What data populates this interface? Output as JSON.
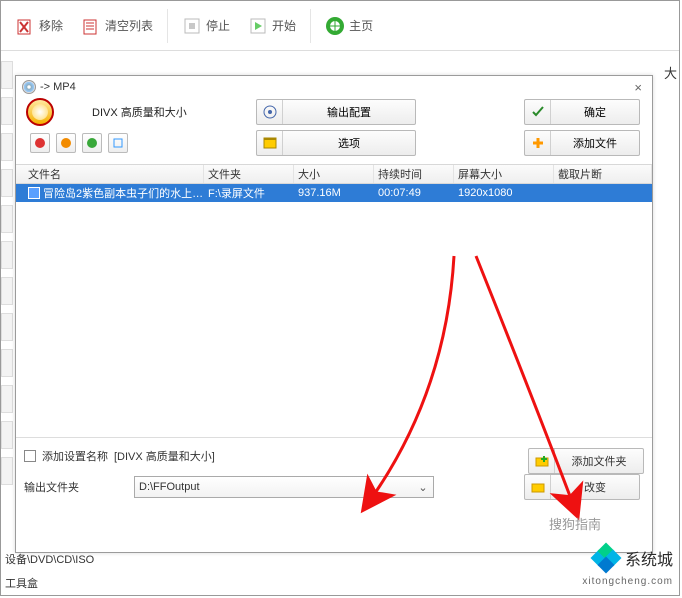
{
  "back_toolbar": {
    "remove": "移除",
    "clear": "清空列表",
    "stop": "停止",
    "start": "开始",
    "home": "主页"
  },
  "dialog": {
    "title": "-> MP4",
    "profile": "DIVX 高质量和大小",
    "btn_output_config": "输出配置",
    "btn_ok": "确定",
    "btn_options": "选项",
    "btn_add_file": "添加文件",
    "columns": {
      "c0": "文件名",
      "c1": "文件夹",
      "c2": "大小",
      "c3": "持续时间",
      "c4": "屏幕大小",
      "c5": "截取片断"
    },
    "row": {
      "name": "冒险岛2紫色副本虫子们的水上乐园水...",
      "folder": "F:\\录屏文件",
      "size": "937.16M",
      "duration": "00:07:49",
      "screen": "1920x1080",
      "clip": ""
    },
    "add_settings_label": "添加设置名称",
    "add_settings_value": "[DIVX 高质量和大小]",
    "btn_add_folder": "添加文件夹",
    "output_label": "输出文件夹",
    "output_path": "D:\\FFOutput",
    "btn_change": "改变"
  },
  "bottom": {
    "devices": "设备\\DVD\\CD\\ISO",
    "tools": "工具盒"
  },
  "page_edge": "大",
  "watermark_text": "系统城",
  "watermark_url": "xitongcheng.com",
  "watermark_hint": "搜狗指南"
}
